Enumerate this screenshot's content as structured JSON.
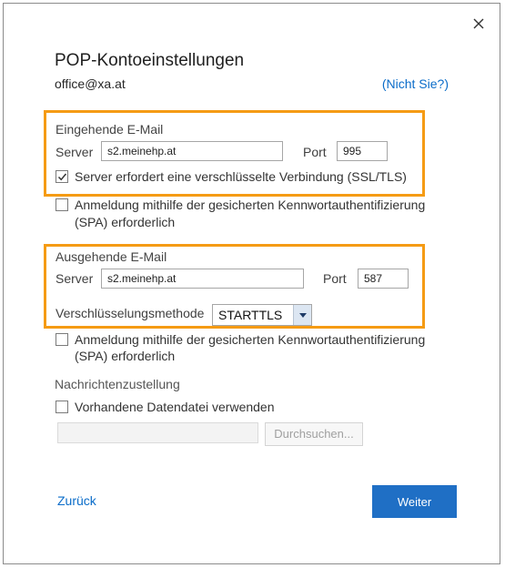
{
  "dialog": {
    "title": "POP-Kontoeinstellungen",
    "account": "office@xa.at",
    "not_you": "(Nicht Sie?)"
  },
  "incoming": {
    "section_title": "Eingehende E-Mail",
    "server_label": "Server",
    "server_value": "s2.meinehp.at",
    "port_label": "Port",
    "port_value": "995",
    "ssl_label": "Server erfordert eine verschlüsselte Verbindung (SSL/TLS)",
    "ssl_checked": true,
    "spa_label_line1": "Anmeldung mithilfe der gesicherten Kennwortauthentifizierung",
    "spa_label_line2": "(SPA) erforderlich",
    "spa_checked": false
  },
  "outgoing": {
    "section_title": "Ausgehende E-Mail",
    "server_label": "Server",
    "server_value": "s2.meinehp.at",
    "port_label": "Port",
    "port_value": "587",
    "encryption_label": "Verschlüsselungsmethode",
    "encryption_value": "STARTTLS",
    "spa_label_line1": "Anmeldung mithilfe der gesicherten Kennwortauthentifizierung",
    "spa_label_line2": "(SPA) erforderlich",
    "spa_checked": false
  },
  "delivery": {
    "section_title": "Nachrichtenzustellung",
    "existing_file_label": "Vorhandene Datendatei verwenden",
    "existing_file_checked": false,
    "browse_label": "Durchsuchen..."
  },
  "footer": {
    "back_label": "Zurück",
    "next_label": "Weiter"
  },
  "colors": {
    "highlight": "#f59b14",
    "link": "#0a6cc9",
    "primary_button": "#1f6fc5"
  },
  "icons": [
    "close-icon",
    "checkmark-icon",
    "dropdown-arrow-icon"
  ]
}
